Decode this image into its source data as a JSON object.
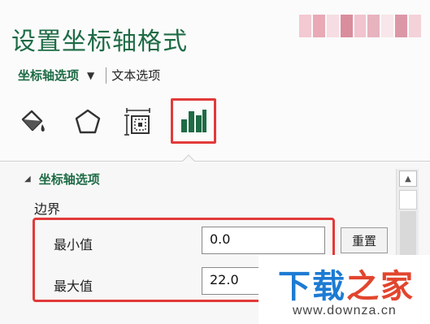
{
  "pane": {
    "title": "设置坐标轴格式",
    "tabs": {
      "active": "坐标轴选项",
      "dropdown_arrow": "▼",
      "secondary": "文本选项"
    },
    "icons": [
      "fill-line-icon",
      "effects-pentagon-icon",
      "size-properties-icon",
      "axis-options-bar-chart-icon"
    ],
    "accent_color": "#1e6b45",
    "highlight_color": "#e23a3a"
  },
  "section": {
    "header": "坐标轴选项",
    "collapse_arrow": "◢",
    "bounds_label": "边界",
    "min_label": "最小值",
    "min_value": "0.0",
    "max_label": "最大值",
    "max_value": "22.0",
    "reset_label": "重置"
  },
  "scrollbar": {
    "up_arrow": "▲"
  },
  "watermark": {
    "text_part1": "下载",
    "text_part2": "之家",
    "url": "www.downza.cn"
  }
}
